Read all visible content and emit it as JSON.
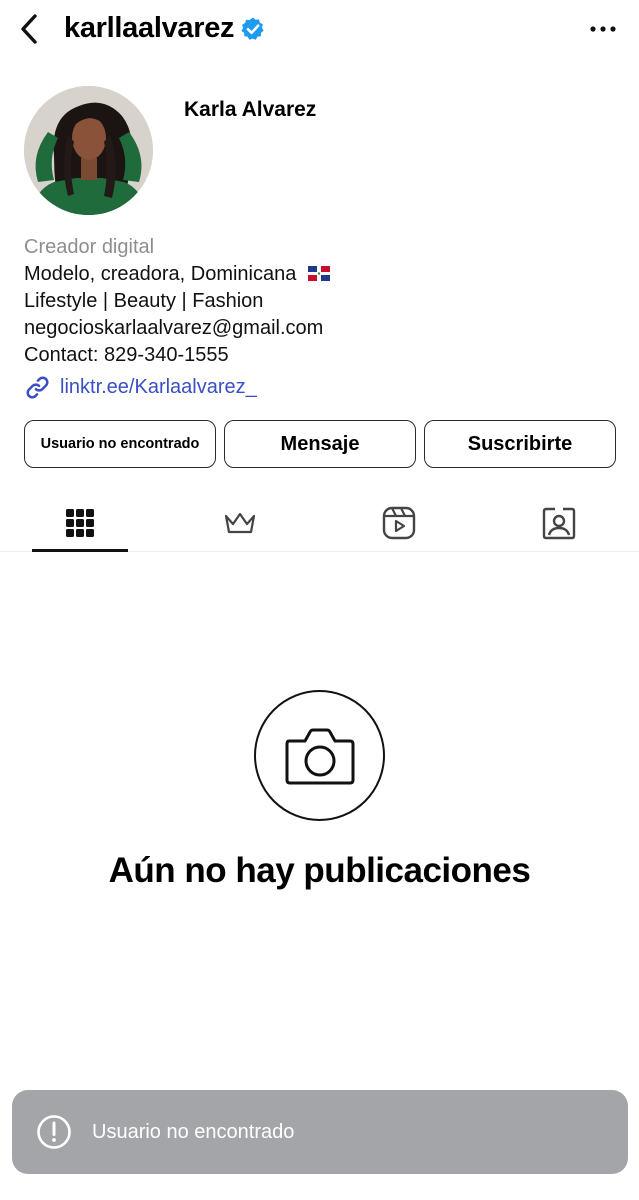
{
  "header": {
    "username": "karllaalvarez",
    "verified": true
  },
  "profile": {
    "display_name": "Karla Alvarez",
    "category": "Creador digital",
    "bio_lines": [
      "Modelo, creadora, Dominicana",
      "Lifestyle | Beauty | Fashion",
      "negocioskarlaalvarez@gmail.com",
      "Contact: 829-340-1555"
    ],
    "link": "linktr.ee/Karlaalvarez_"
  },
  "actions": {
    "user_not_found": "Usuario no encontrado",
    "message": "Mensaje",
    "subscribe": "Suscribirte"
  },
  "tabs": [
    {
      "icon": "grid-icon",
      "active": true
    },
    {
      "icon": "crown-icon",
      "active": false
    },
    {
      "icon": "reels-icon",
      "active": false
    },
    {
      "icon": "tagged-icon",
      "active": false
    }
  ],
  "empty_state": {
    "title": "Aún no hay publicaciones"
  },
  "toast": {
    "text": "Usuario no encontrado"
  },
  "colors": {
    "verified_badge": "#1d9bf0",
    "link": "#3a4fc4",
    "toast_bg": "#a3a5a9",
    "category_text": "#8e8e8e"
  }
}
